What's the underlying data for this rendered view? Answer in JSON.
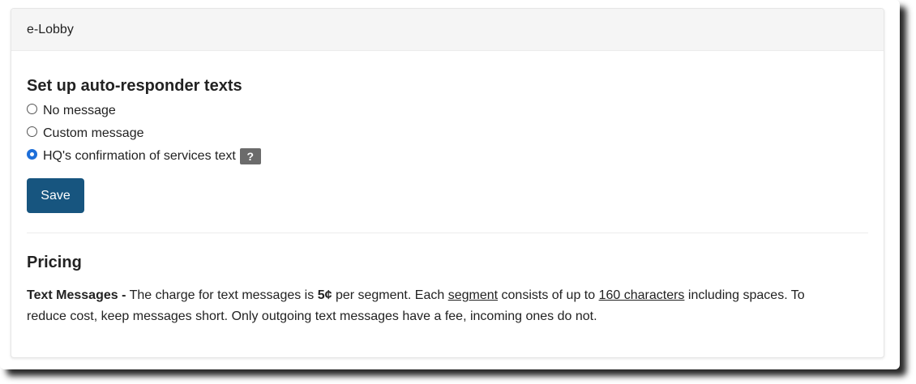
{
  "header": {
    "title": "e-Lobby"
  },
  "autoresponder": {
    "title": "Set up auto-responder texts",
    "options": [
      {
        "label": "No message",
        "checked": false
      },
      {
        "label": "Custom message",
        "checked": false
      },
      {
        "label": "HQ's confirmation of services text",
        "checked": true
      }
    ],
    "help_label": "?",
    "save_label": "Save"
  },
  "pricing": {
    "title": "Pricing",
    "lead_bold": "Text Messages -",
    "text_part1": "The charge for text messages is",
    "price": "5¢",
    "text_part2": "per segment. Each",
    "link_segment": "segment",
    "text_part3": "consists of up to",
    "link_characters": "160 characters",
    "text_part4": "including spaces. To reduce cost, keep messages short. Only outgoing text messages have a fee, incoming ones do not."
  },
  "colors": {
    "primary": "#17557f",
    "radio_checked": "#1e6fd9",
    "header_bg": "#f5f5f5",
    "help_badge": "#6b6b6b"
  }
}
